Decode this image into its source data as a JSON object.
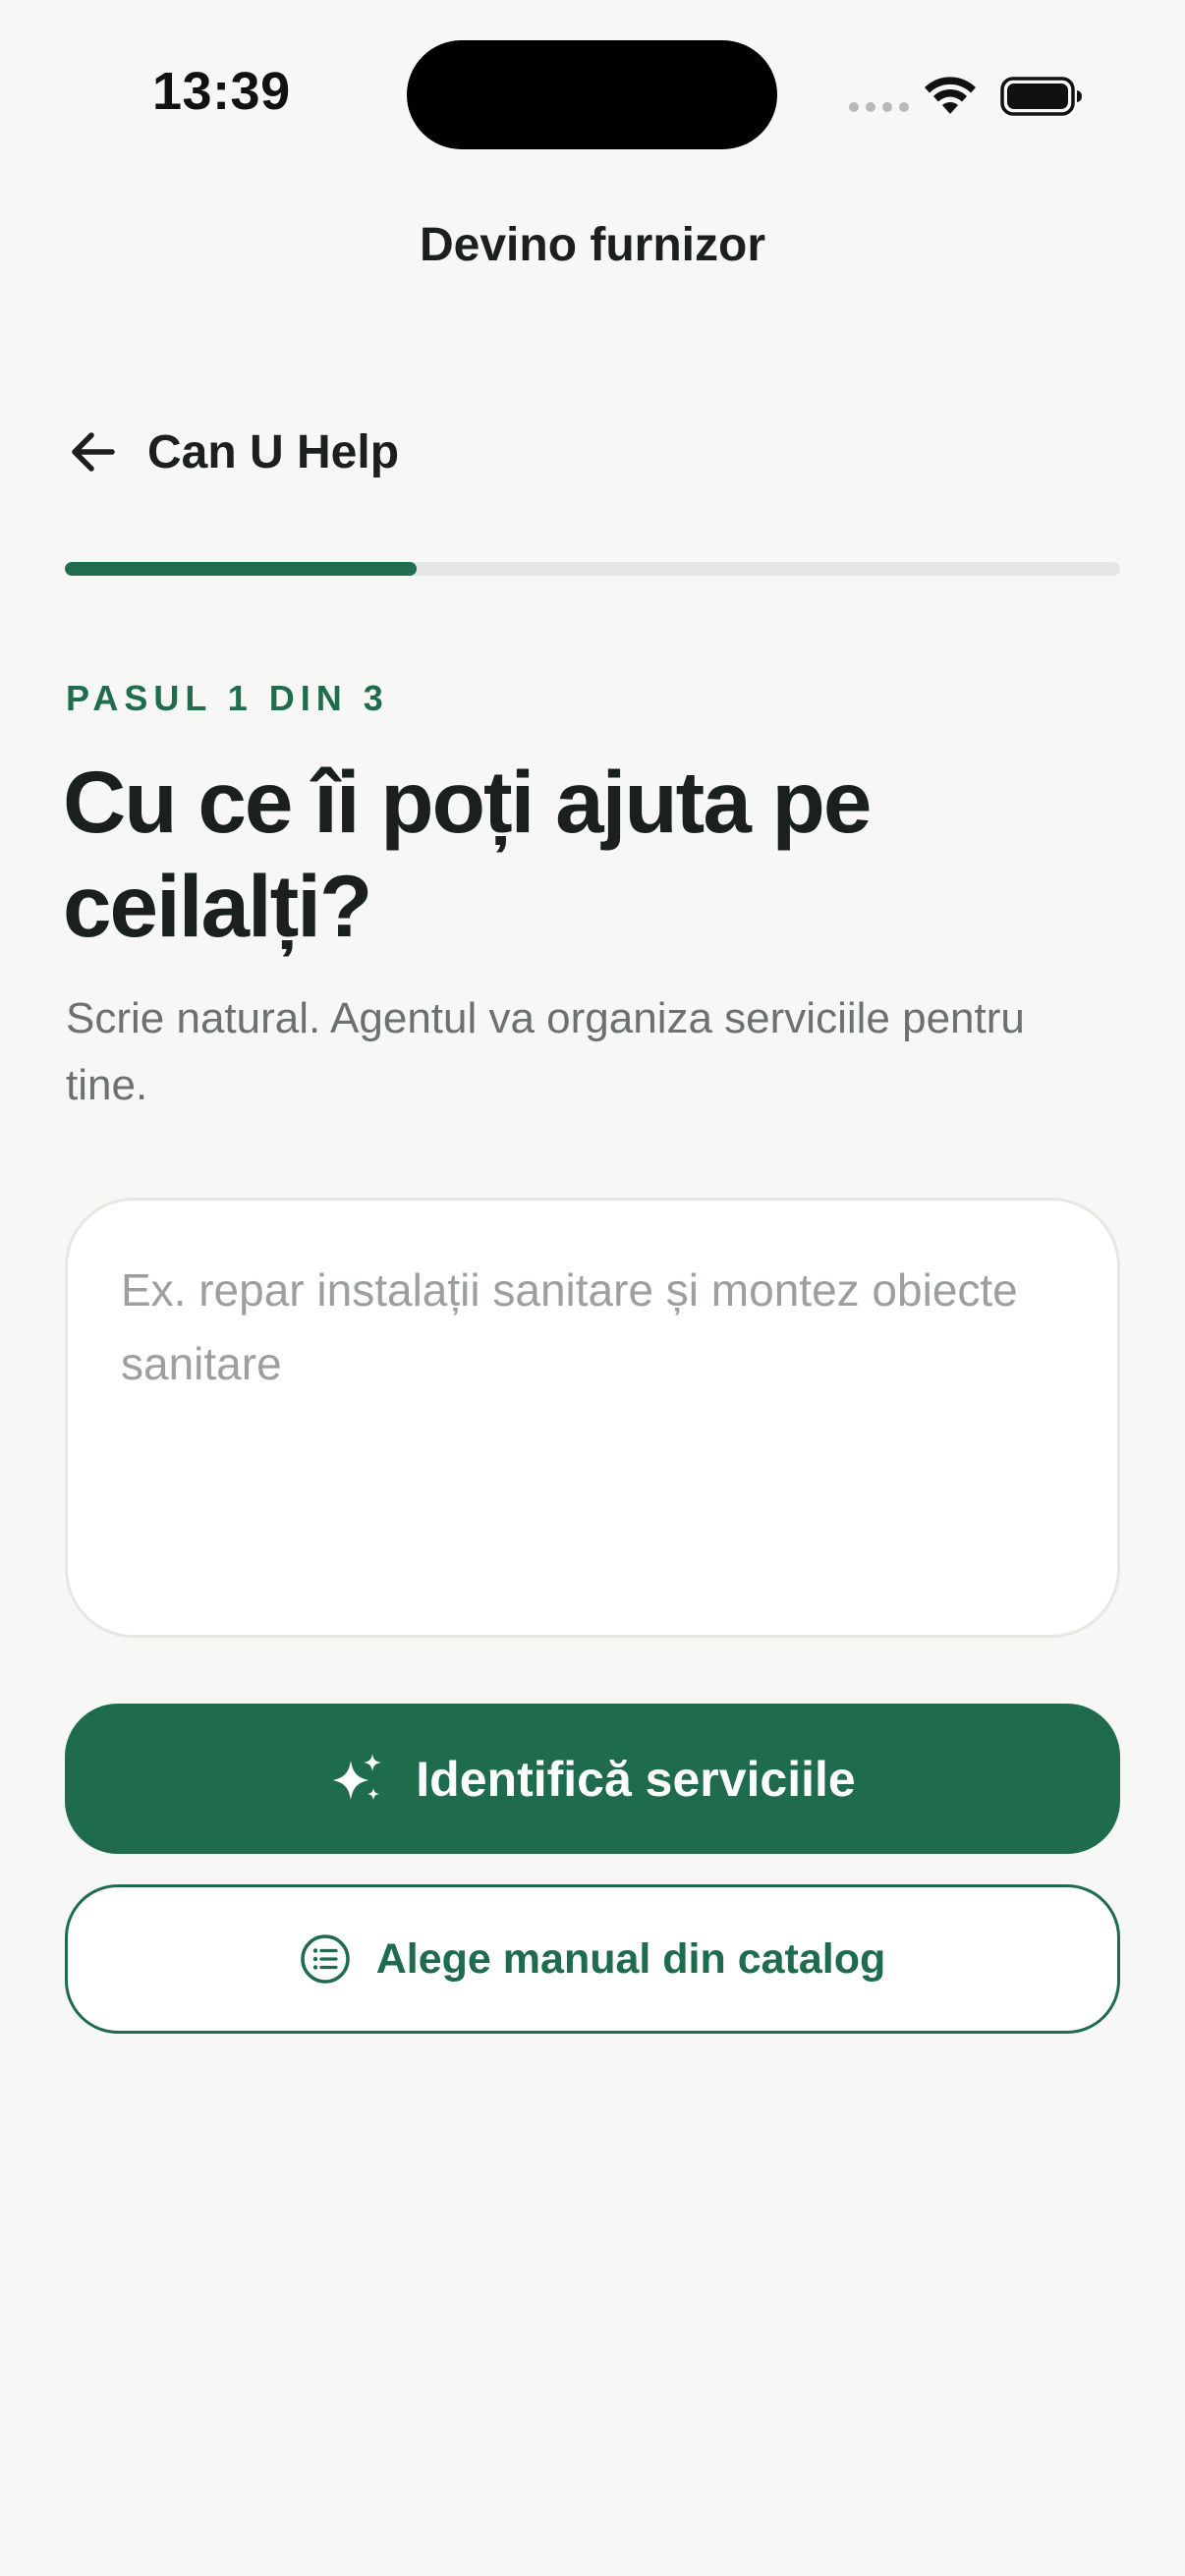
{
  "status_bar": {
    "time": "13:39"
  },
  "header": {
    "title": "Devino furnizor"
  },
  "back": {
    "label": "Can U Help",
    "icon": "arrow-left-icon"
  },
  "progress": {
    "current_step": 1,
    "total_steps": 3,
    "fraction": 0.333,
    "fill_color": "#1f6d4e",
    "track_color": "#e4e6e3"
  },
  "step": {
    "label": "PASUL 1 DIN 3",
    "question": "Cu ce îi poți ajuta pe ceilalți?",
    "helper": "Scrie natural. Agentul va organiza serviciile pentru tine."
  },
  "description_input": {
    "value": "",
    "placeholder": "Ex. repar instalații sanitare și montez obiecte sanitare"
  },
  "actions": {
    "identify_label": "Identifică serviciile",
    "identify_icon": "sparkles-icon",
    "catalog_label": "Alege manual din catalog",
    "catalog_icon": "list-icon"
  },
  "colors": {
    "accent": "#1e6c4d",
    "background": "#f7f7f5",
    "text": "#1a201d",
    "muted": "#6b716e"
  }
}
